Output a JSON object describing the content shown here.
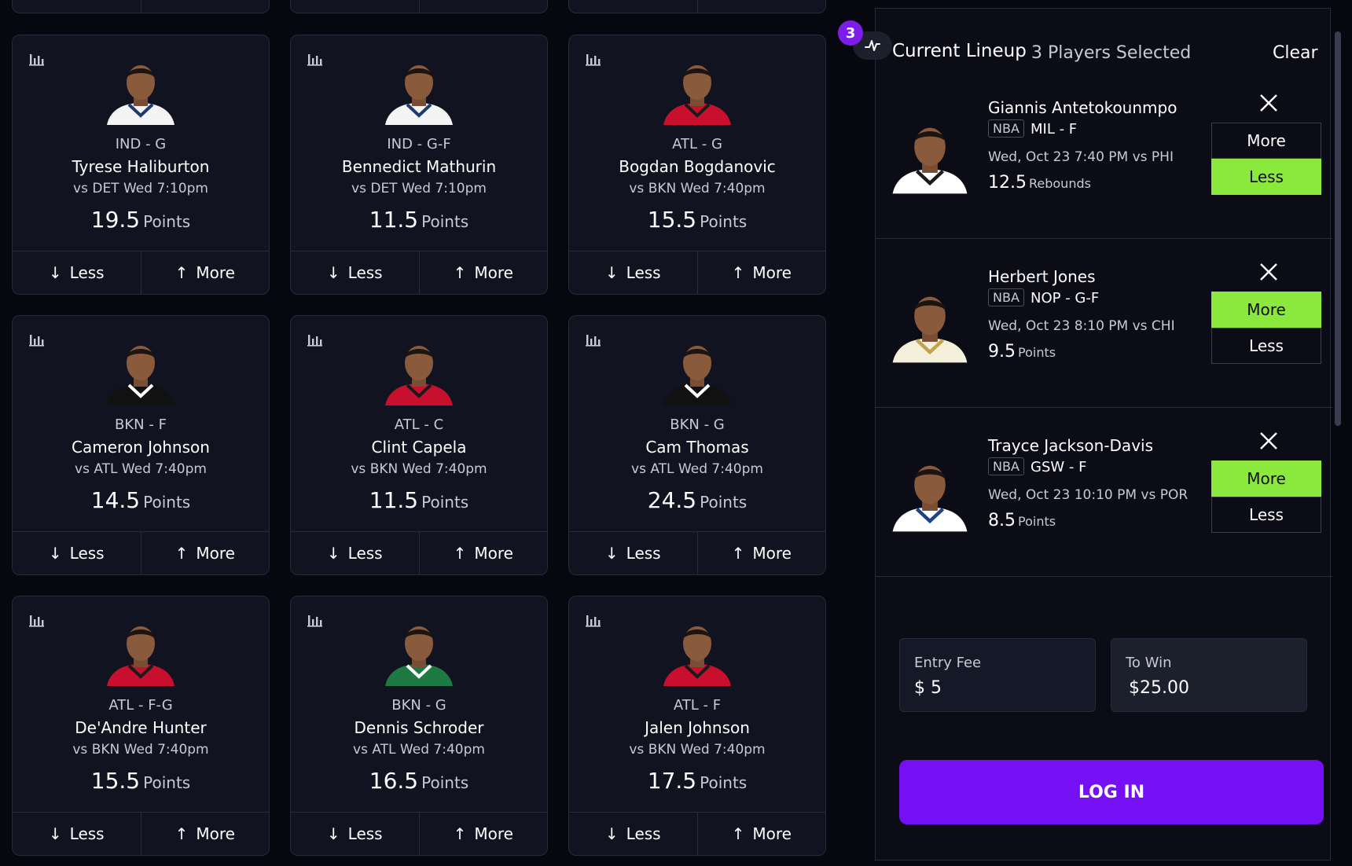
{
  "grid": {
    "cards": [
      {
        "team_pos": "IND - G",
        "name": "Tyrese Haliburton",
        "game": "vs DET Wed 7:10pm",
        "value": "19.5",
        "unit": "Points",
        "jersey": "#f4f4f4",
        "trim": "#1d3a6e"
      },
      {
        "team_pos": "IND - G-F",
        "name": "Bennedict Mathurin",
        "game": "vs DET Wed 7:10pm",
        "value": "11.5",
        "unit": "Points",
        "jersey": "#f4f4f4",
        "trim": "#1d3a6e"
      },
      {
        "team_pos": "ATL - G",
        "name": "Bogdan Bogdanovic",
        "game": "vs BKN Wed 7:40pm",
        "value": "15.5",
        "unit": "Points",
        "jersey": "#c8102e",
        "trim": "#1a1a1a"
      },
      {
        "team_pos": "BKN - F",
        "name": "Cameron Johnson",
        "game": "vs ATL Wed 7:40pm",
        "value": "14.5",
        "unit": "Points",
        "jersey": "#111111",
        "trim": "#ffffff"
      },
      {
        "team_pos": "ATL - C",
        "name": "Clint Capela",
        "game": "vs BKN Wed 7:40pm",
        "value": "11.5",
        "unit": "Points",
        "jersey": "#c8102e",
        "trim": "#1a1a1a"
      },
      {
        "team_pos": "BKN - G",
        "name": "Cam Thomas",
        "game": "vs ATL Wed 7:40pm",
        "value": "24.5",
        "unit": "Points",
        "jersey": "#111111",
        "trim": "#ffffff"
      },
      {
        "team_pos": "ATL - F-G",
        "name": "De'Andre Hunter",
        "game": "vs BKN Wed 7:40pm",
        "value": "15.5",
        "unit": "Points",
        "jersey": "#c8102e",
        "trim": "#1a1a1a"
      },
      {
        "team_pos": "BKN - G",
        "name": "Dennis Schroder",
        "game": "vs ATL Wed 7:40pm",
        "value": "16.5",
        "unit": "Points",
        "jersey": "#1e7a43",
        "trim": "#ffffff"
      },
      {
        "team_pos": "ATL - F",
        "name": "Jalen Johnson",
        "game": "vs BKN Wed 7:40pm",
        "value": "17.5",
        "unit": "Points",
        "jersey": "#c8102e",
        "trim": "#1a1a1a"
      }
    ],
    "less_label": "Less",
    "more_label": "More"
  },
  "lineup": {
    "count": "3",
    "title": "Current Lineup",
    "selected_text": "3 Players Selected",
    "clear_label": "Clear",
    "picks": [
      {
        "name": "Giannis Antetokounmpo",
        "league": "NBA",
        "team_pos": "MIL - F",
        "game": "Wed, Oct 23 7:40 PM vs PHI",
        "value": "12.5",
        "unit": "Rebounds",
        "more": "More",
        "less": "Less",
        "selected": "less",
        "jersey": "#ffffff",
        "trim": "#1a1a1a"
      },
      {
        "name": "Herbert Jones",
        "league": "NBA",
        "team_pos": "NOP - G-F",
        "game": "Wed, Oct 23 8:10 PM vs CHI",
        "value": "9.5",
        "unit": "Points",
        "more": "More",
        "less": "Less",
        "selected": "more",
        "jersey": "#f4f0dc",
        "trim": "#c2a24a"
      },
      {
        "name": "Trayce Jackson-Davis",
        "league": "NBA",
        "team_pos": "GSW - F",
        "game": "Wed, Oct 23 10:10 PM vs POR",
        "value": "8.5",
        "unit": "Points",
        "more": "More",
        "less": "Less",
        "selected": "more",
        "jersey": "#ffffff",
        "trim": "#1d428a"
      }
    ],
    "entry_fee_label": "Entry Fee",
    "entry_fee_value": "$ 5",
    "to_win_label": "To Win",
    "to_win_value": "$25.00",
    "login_label": "LOG IN"
  },
  "colors": {
    "accent_purple": "#7510f5",
    "selected_green": "#8be83c",
    "background": "#07080f",
    "card": "#111320"
  }
}
